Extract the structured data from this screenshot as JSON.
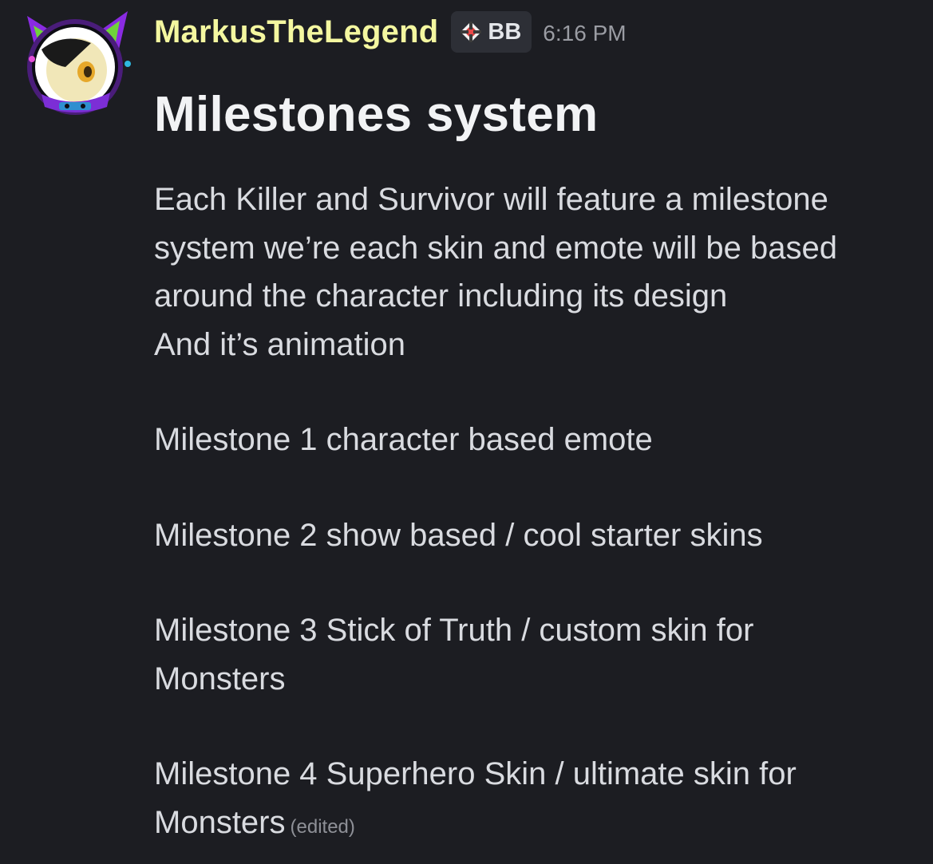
{
  "message": {
    "author": {
      "username": "MarkusTheLegend",
      "username_color": "#f4f7a0",
      "avatar_icon": "cat-avatar-icon",
      "badge": {
        "icon": "diamond-compass-icon",
        "label": "BB"
      }
    },
    "timestamp": "6:16 PM",
    "heading": "Milestones system",
    "lines": {
      "l1": "Each Killer and Survivor will feature a milestone",
      "l2": "system we’re each skin and emote will be based",
      "l3": "around the character including its design",
      "l4": "And it’s animation",
      "m1": "Milestone 1  character based emote",
      "m2": "Milestone 2 show based / cool starter skins",
      "m3a": "Milestone 3 Stick of Truth / custom skin for",
      "m3b": "Monsters",
      "m4a": "Milestone 4 Superhero Skin / ultimate skin for",
      "m4b": "Monsters"
    },
    "edited_label": "(edited)"
  }
}
